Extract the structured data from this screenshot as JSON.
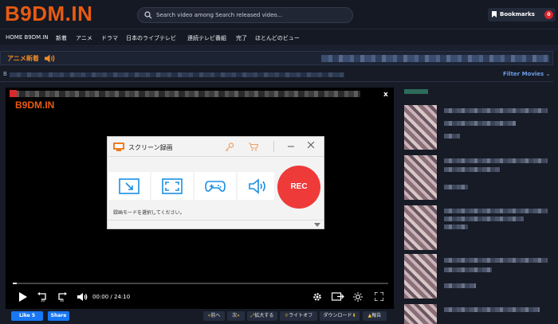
{
  "header": {
    "logo": "B9DM.IN",
    "search_placeholder": "Search video among Search released video...",
    "bookmarks_label": "Bookmarks",
    "bookmarks_count": "0"
  },
  "nav": {
    "items": [
      "HOME B9DM.IN",
      "新着",
      "アニメ",
      "ドラマ",
      "日本のライブテレビ",
      "連続テレビ番組",
      "完了",
      "ほとんどのビュー"
    ]
  },
  "section": {
    "title": "アニメ新着",
    "sub_label": "B",
    "filter_label": "Filter Movies"
  },
  "player": {
    "watermark": "B9DM.IN",
    "close_label": "x",
    "time_current": "00:00",
    "time_sep": "/",
    "time_total": "24:10",
    "progress": 0.01
  },
  "recorder": {
    "title": "スクリーン録画",
    "rec_label": "REC",
    "message": "録画モードを選択してください。"
  },
  "actions": {
    "like_label": "Like 5",
    "share_label": "Share",
    "buttons": [
      "前へ",
      "次",
      "拡大する",
      "ライトオフ",
      "ダウンロード",
      "報告"
    ]
  },
  "colors": {
    "accent": "#e85a12",
    "rec": "#ef3a3a",
    "link": "#6c9ce6",
    "badge": "#d9252c"
  }
}
